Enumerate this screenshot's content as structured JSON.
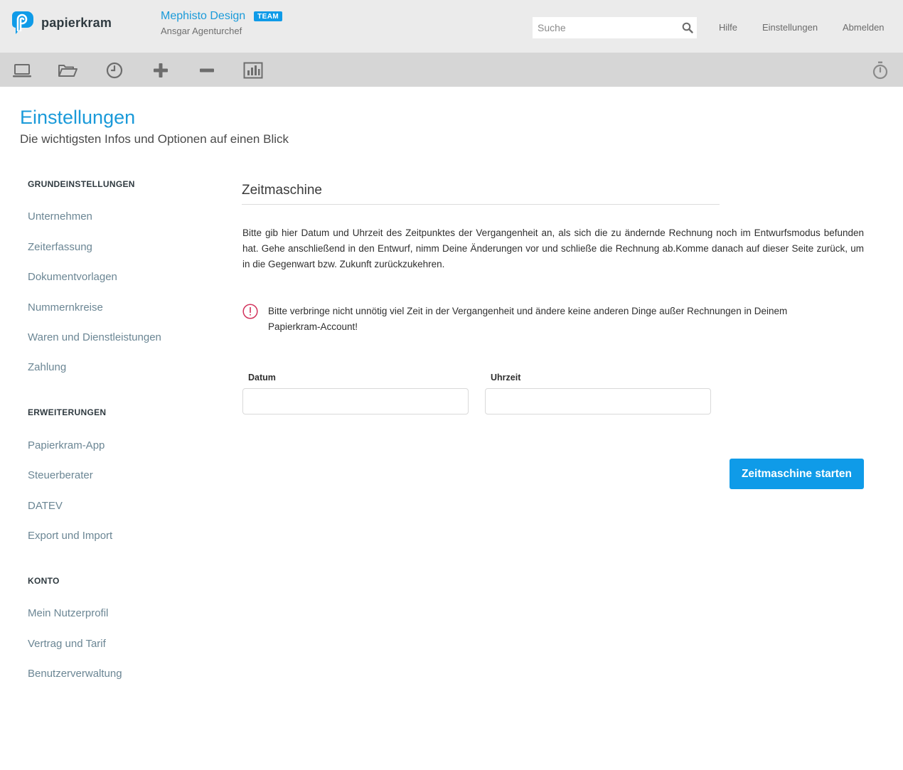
{
  "header": {
    "logo_text": "papierkram",
    "company_name": "Mephisto Design",
    "team_badge": "TEAM",
    "company_user": "Ansgar Agenturchef",
    "search_placeholder": "Suche",
    "nav": [
      "Hilfe",
      "Einstellungen",
      "Abmelden"
    ]
  },
  "toolbar": {
    "icons": [
      "laptop-icon",
      "folder-open-icon",
      "clock-icon",
      "plus-icon",
      "minus-icon",
      "bar-chart-icon"
    ],
    "right_icon": "stopwatch-icon"
  },
  "page": {
    "title": "Einstellungen",
    "subtitle": "Die wichtigsten Infos und Optionen auf einen Blick"
  },
  "sidebar": {
    "sections": [
      {
        "heading": "GRUNDEINSTELLUNGEN",
        "items": [
          "Unternehmen",
          "Zeiterfassung",
          "Dokumentvorlagen",
          "Nummernkreise",
          "Waren und Dienstleistungen",
          "Zahlung"
        ]
      },
      {
        "heading": "ERWEITERUNGEN",
        "items": [
          "Papierkram-App",
          "Steuerberater",
          "DATEV",
          "Export und Import"
        ]
      },
      {
        "heading": "KONTO",
        "items": [
          "Mein Nutzerprofil",
          "Vertrag und Tarif",
          "Benutzerverwaltung"
        ]
      }
    ]
  },
  "main": {
    "section_title": "Zeitmaschine",
    "intro": "Bitte gib hier Datum und Uhrzeit des Zeitpunktes der Vergangenheit an, als sich die zu ändernde Rechnung noch im Entwurfsmodus befunden hat. Gehe anschließend in den Entwurf, nimm Deine Änderungen vor und schließe die Rechnung ab.Komme danach auf dieser Seite zurück, um in die Gegenwart bzw. Zukunft zurückzukehren.",
    "warning": "Bitte verbringe nicht unnötig viel Zeit in der Vergangenheit und ändere keine anderen Dinge außer Rechnungen in Deinem Papierkram-Account!",
    "date_label": "Datum",
    "date_value": "",
    "time_label": "Uhrzeit",
    "time_value": "",
    "submit_label": "Zeitmaschine starten"
  },
  "colors": {
    "accent": "#0f9be8",
    "link": "#6b8694",
    "warning": "#d2335c",
    "header_bg": "#ebebeb",
    "toolbar_bg": "#d6d6d6"
  }
}
